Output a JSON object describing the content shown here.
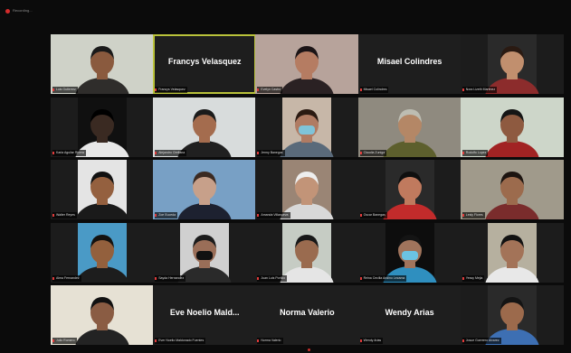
{
  "window": {
    "recording_label": "Recording..."
  },
  "colors": {
    "active_speaker": "#b9c23a",
    "mic_muted": "#e03a3a",
    "tile_bg": "#222222"
  },
  "tiles": [
    {
      "label": "Luis Gutierrez",
      "type": "video",
      "bg": "#cfd2c8",
      "skin": "#8a5a3e",
      "shirt": "#2f2d2b",
      "hair": "#1a1a1a"
    },
    {
      "label": "Francys Velasquez",
      "type": "name",
      "display_name": "Francys Velasquez",
      "active": true
    },
    {
      "label": "Evelyn Castro",
      "type": "video",
      "bg": "#b7a39b",
      "skin": "#b57c62",
      "shirt": "#2a2123",
      "hair": "#1b1416"
    },
    {
      "label": "Misael Colindres",
      "type": "name",
      "display_name": "Misael Colindres"
    },
    {
      "label": "Nora Lizeth Martinez",
      "type": "video",
      "bg": "#2a2a2a",
      "skin": "#c18f6e",
      "shirt": "#8c2c2c",
      "hair": "#2a1a12",
      "narrow": true
    },
    {
      "label": "Karla Aguilar Rivera",
      "type": "video",
      "bg": "#101010",
      "skin": "#3a2a22",
      "shirt": "#e8e8e8",
      "hair": "#000000",
      "narrow": true
    },
    {
      "label": "Alejandro Orellana",
      "type": "video",
      "bg": "#d8dcdc",
      "skin": "#a46c4e",
      "shirt": "#202020",
      "hair": "#1b1b1b"
    },
    {
      "label": "Jenny Banegas",
      "type": "video",
      "bg": "#c7b7a8",
      "skin": "#b07b63",
      "shirt": "#5a6a7a",
      "hair": "#2b1a12",
      "mask": "#7fc3d9",
      "narrow": true
    },
    {
      "label": "Claudia Zuniga",
      "type": "video",
      "bg": "#8f8a7f",
      "skin": "#b48766",
      "shirt": "#5d5f2d",
      "hair": "#bdbdb2"
    },
    {
      "label": "Rodolfo Lopez",
      "type": "video",
      "bg": "#cdd6c9",
      "skin": "#8e5a40",
      "shirt": "#a12323",
      "hair": "#151515"
    },
    {
      "label": "Walter Reyes",
      "type": "video",
      "bg": "#e4e4e4",
      "skin": "#94603f",
      "shirt": "#1a1a1a",
      "hair": "#111111",
      "narrow": true
    },
    {
      "label": "Zoe Euceda",
      "type": "video",
      "bg": "#78a0c5",
      "skin": "#c7a08a",
      "shirt": "#1d2130",
      "hair": "#3b2a22"
    },
    {
      "label": "Amanda Villanueva",
      "type": "video",
      "bg": "#9a8575",
      "skin": "#c29478",
      "shirt": "#d8d8d8",
      "hair": "#eeeeee",
      "narrow": true
    },
    {
      "label": "Oscar Banegas",
      "type": "video",
      "bg": "#2a2a2a",
      "skin": "#c07a5e",
      "shirt": "#c22b2b",
      "hair": "#0f0f0f",
      "narrow": true
    },
    {
      "label": "Lesly Flores",
      "type": "video",
      "bg": "#a09a8b",
      "skin": "#9c6b4d",
      "shirt": "#7a2c2c",
      "hair": "#1c1410"
    },
    {
      "label": "Alma Fernandez",
      "type": "video",
      "bg": "#4a9ac6",
      "skin": "#93603d",
      "shirt": "#1d1d1d",
      "hair": "#141210",
      "narrow": true
    },
    {
      "label": "Sayda Hernandez",
      "type": "video",
      "bg": "#d0d0d0",
      "skin": "#9a6e58",
      "shirt": "#2a2a2a",
      "hair": "#1c1c1c",
      "mask": "#111111",
      "narrow": true
    },
    {
      "label": "Juan Luis Portillo",
      "type": "video",
      "bg": "#c6ccc4",
      "skin": "#9a6b4f",
      "shirt": "#e5e5e5",
      "hair": "#181818",
      "narrow": true
    },
    {
      "label": "Reina Cecilia Andino Lezama",
      "type": "video",
      "bg": "#0d0d0d",
      "skin": "#a0745c",
      "shirt": "#2f8fbf",
      "hair": "#141414",
      "mask": "#6bc3e3",
      "narrow": true
    },
    {
      "label": "Yessy Mejia",
      "type": "video",
      "bg": "#b6b09f",
      "skin": "#a37358",
      "shirt": "#e8e8e8",
      "hair": "#121212",
      "narrow": true
    },
    {
      "label": "Julio Romero",
      "type": "video",
      "bg": "#e6e1d4",
      "skin": "#8a5c43",
      "shirt": "#232323",
      "hair": "#111111"
    },
    {
      "label": "Ever Noelio Maldonado Fuentes",
      "type": "name",
      "display_name": "Eve Noelio Mald..."
    },
    {
      "label": "Norma Valerio",
      "type": "name",
      "display_name": "Norma Valerio"
    },
    {
      "label": "Wendy Arias",
      "type": "name",
      "display_name": "Wendy Arias"
    },
    {
      "label": "Josue Guerrero Alvarez",
      "type": "video",
      "bg": "#2a2a2a",
      "skin": "#9c6a4c",
      "shirt": "#3d6fb3",
      "hair": "#141414",
      "narrow": true
    }
  ]
}
